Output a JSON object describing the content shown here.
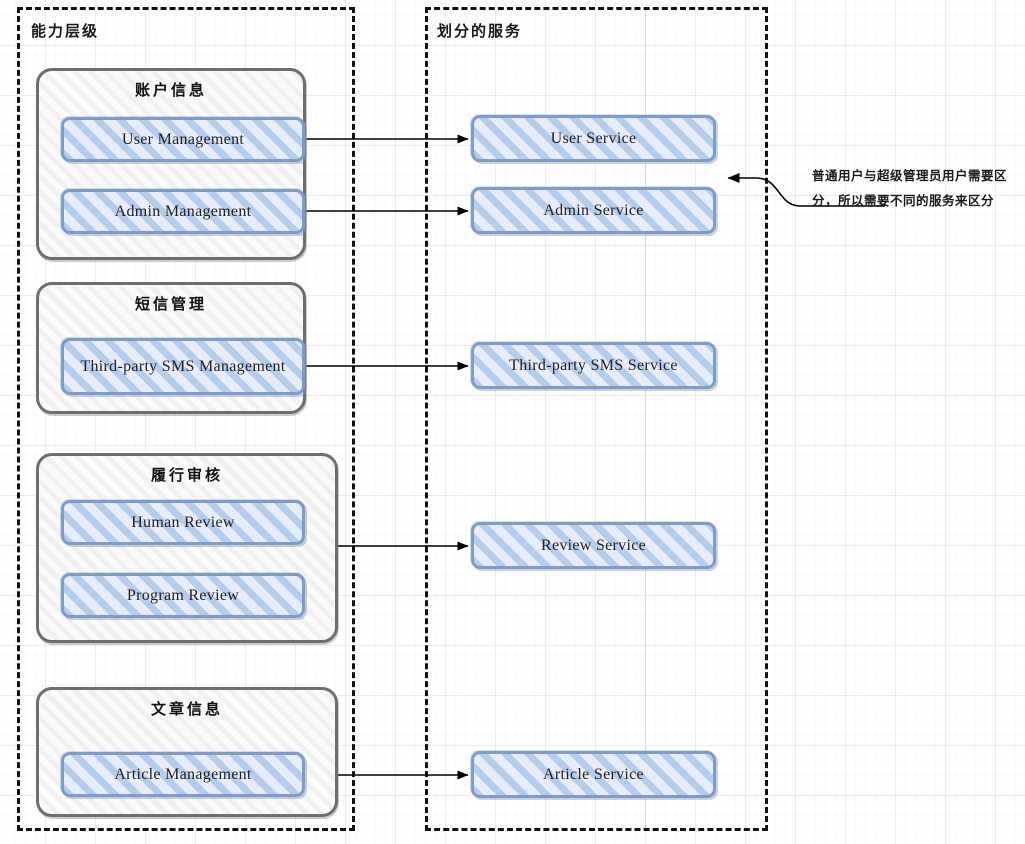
{
  "diagram": {
    "title": "Capability Hierarchy to Service Decomposition",
    "colors": {
      "lane_border": "#111111",
      "group_border": "#6e6e6e",
      "group_fill": "#fafafa",
      "box_border": "#7e9cc6",
      "box_fill": "#e4edf9",
      "hatch": "#8eb1dd",
      "arrow": "#000000",
      "grid_major": "#e0e0e0",
      "grid_minor": "#f2f2f2"
    }
  },
  "lanes": [
    {
      "id": "capability",
      "label": "能力层级"
    },
    {
      "id": "service",
      "label": "划分的服务"
    }
  ],
  "groups": [
    {
      "id": "account",
      "title": "账户信息",
      "items": [
        {
          "id": "user-management",
          "label": "User  Management"
        },
        {
          "id": "admin-management",
          "label": "Admin  Management"
        }
      ]
    },
    {
      "id": "sms",
      "title": "短信管理",
      "items": [
        {
          "id": "third-party-sms-management",
          "label": "Third-party SMS\nManagement"
        }
      ]
    },
    {
      "id": "review",
      "title": "履行审核",
      "items": [
        {
          "id": "human-review",
          "label": "Human Review"
        },
        {
          "id": "program-review",
          "label": "Program Review"
        }
      ]
    },
    {
      "id": "article",
      "title": "文章信息",
      "items": [
        {
          "id": "article-management",
          "label": "Article  Management"
        }
      ]
    }
  ],
  "services": [
    {
      "id": "user-service",
      "label": "User  Service"
    },
    {
      "id": "admin-service",
      "label": "Admin  Service"
    },
    {
      "id": "third-party-sms-service",
      "label": "Third-party SMS  Service"
    },
    {
      "id": "review-service",
      "label": "Review  Service"
    },
    {
      "id": "article-service",
      "label": "Article  Service"
    }
  ],
  "annotation": {
    "id": "admin-service-note",
    "text": "普通用户与超级管理员用户需要区\n分，所以需要不同的服务来区分",
    "points_to": "admin-service"
  },
  "connections": [
    {
      "from": "user-management",
      "to": "user-service"
    },
    {
      "from": "admin-management",
      "to": "admin-service"
    },
    {
      "from": "third-party-sms-management",
      "to": "third-party-sms-service"
    },
    {
      "from": "review",
      "to": "review-service"
    },
    {
      "from": "article-management",
      "to": "article-service"
    }
  ]
}
